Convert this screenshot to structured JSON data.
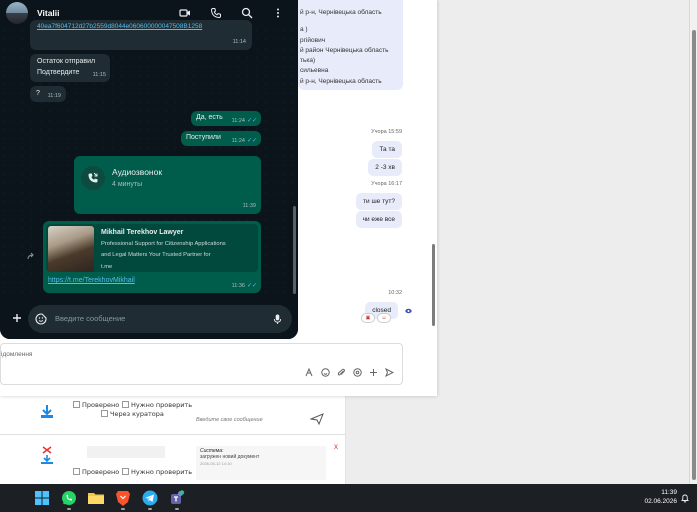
{
  "whatsapp": {
    "contact_name": "Vitalii",
    "header_icons": [
      "video-call-icon",
      "phone-icon",
      "search-icon",
      "kebab-menu-icon"
    ],
    "messages": {
      "link_fragment": "40ea7f604712d27b2559d8044e060600000047508B1258",
      "link_fragment_time": "11:14",
      "msg1_line1": "Остаток отправил",
      "msg1_line2": "Подтвердите",
      "msg1_time": "11:15",
      "msg2_text": "?",
      "msg2_time": "11:19",
      "out1_text": "Да, есть",
      "out1_time": "11:24",
      "out2_text": "Поступили",
      "out2_time": "11:24",
      "call_title": "Аудиозвонок",
      "call_duration": "4 минуты",
      "call_time": "11:39",
      "preview_title": "Mikhail Terekhov Lawyer",
      "preview_desc_line1": "Professional Support for Citizenship Applications",
      "preview_desc_line2": "and Legal Matters Your Trusted Partner for",
      "preview_domain": "t.me",
      "preview_link": "https://t.me/TerekhovMikhail",
      "preview_time": "11:36"
    },
    "input_placeholder": "Введите сообщение",
    "read_receipt": "✓✓"
  },
  "messenger": {
    "partner_card_lines": [
      "й р-н, Чернівецька область",
      "а )",
      "ргійович",
      "й район Чернівецька область",
      "тька)",
      "сильевна",
      "й  р-н, Чернівецька область"
    ],
    "bubbles": [
      {
        "time": "Учора 15:59",
        "text": "Та та"
      },
      {
        "time": "",
        "text": "2 -3 хв"
      },
      {
        "time": "Учора 16:17",
        "text": "ти ше тут?"
      },
      {
        "time": "",
        "text": "чи еже все"
      },
      {
        "time": "10:32",
        "text": "closed"
      }
    ],
    "compose_placeholder": "ідомлення"
  },
  "background_page": {
    "row1": {
      "checkbox_checked": "Проверено",
      "checkbox_need": "Нужно проверить",
      "checkbox_curator": "Через куратора",
      "comment_placeholder": "Введите свое сообщение"
    },
    "row2": {
      "checkbox_checked": "Проверено",
      "checkbox_need": "Нужно проверить",
      "note_title": "Система:",
      "note_text": "загружен новий документ",
      "note_time": "2026-05-12 14:10",
      "close_x": "x"
    }
  },
  "taskbar": {
    "apps": [
      "windows-start-icon",
      "whatsapp-icon",
      "file-explorer-icon",
      "brave-browser-icon",
      "telegram-icon",
      "teams-icon"
    ],
    "time": "11:39",
    "date": "02.06.2026"
  },
  "colors": {
    "wa_bg": "#0b141a",
    "wa_incoming": "#1f2c33",
    "wa_outgoing": "#005c4b",
    "wa_link": "#53bdeb",
    "messenger_bubble": "#e8ecfa",
    "taskbar": "#1c1f24"
  }
}
